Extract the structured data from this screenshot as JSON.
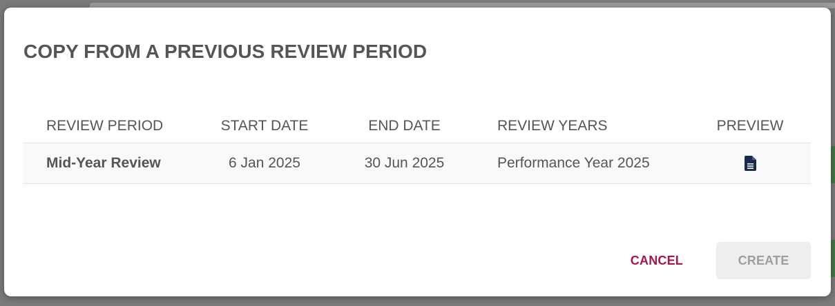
{
  "dialog": {
    "title": "COPY FROM A PREVIOUS REVIEW PERIOD",
    "columns": {
      "review_period": "REVIEW PERIOD",
      "start_date": "START DATE",
      "end_date": "END DATE",
      "review_years": "REVIEW YEARS",
      "preview": "PREVIEW"
    },
    "rows": [
      {
        "review_period": "Mid-Year Review",
        "start_date": "6 Jan 2025",
        "end_date": "30 Jun 2025",
        "review_years": "Performance Year 2025",
        "preview_icon": "document-icon"
      }
    ],
    "actions": {
      "cancel_label": "CANCEL",
      "create_label": "CREATE"
    }
  },
  "colors": {
    "title_text": "#555555",
    "cancel_text": "#a5154f",
    "create_disabled_bg": "#eeeeee",
    "create_disabled_text": "#9e9e9e",
    "preview_icon": "#1b2a4a",
    "row_background": "#f9f9f9"
  }
}
